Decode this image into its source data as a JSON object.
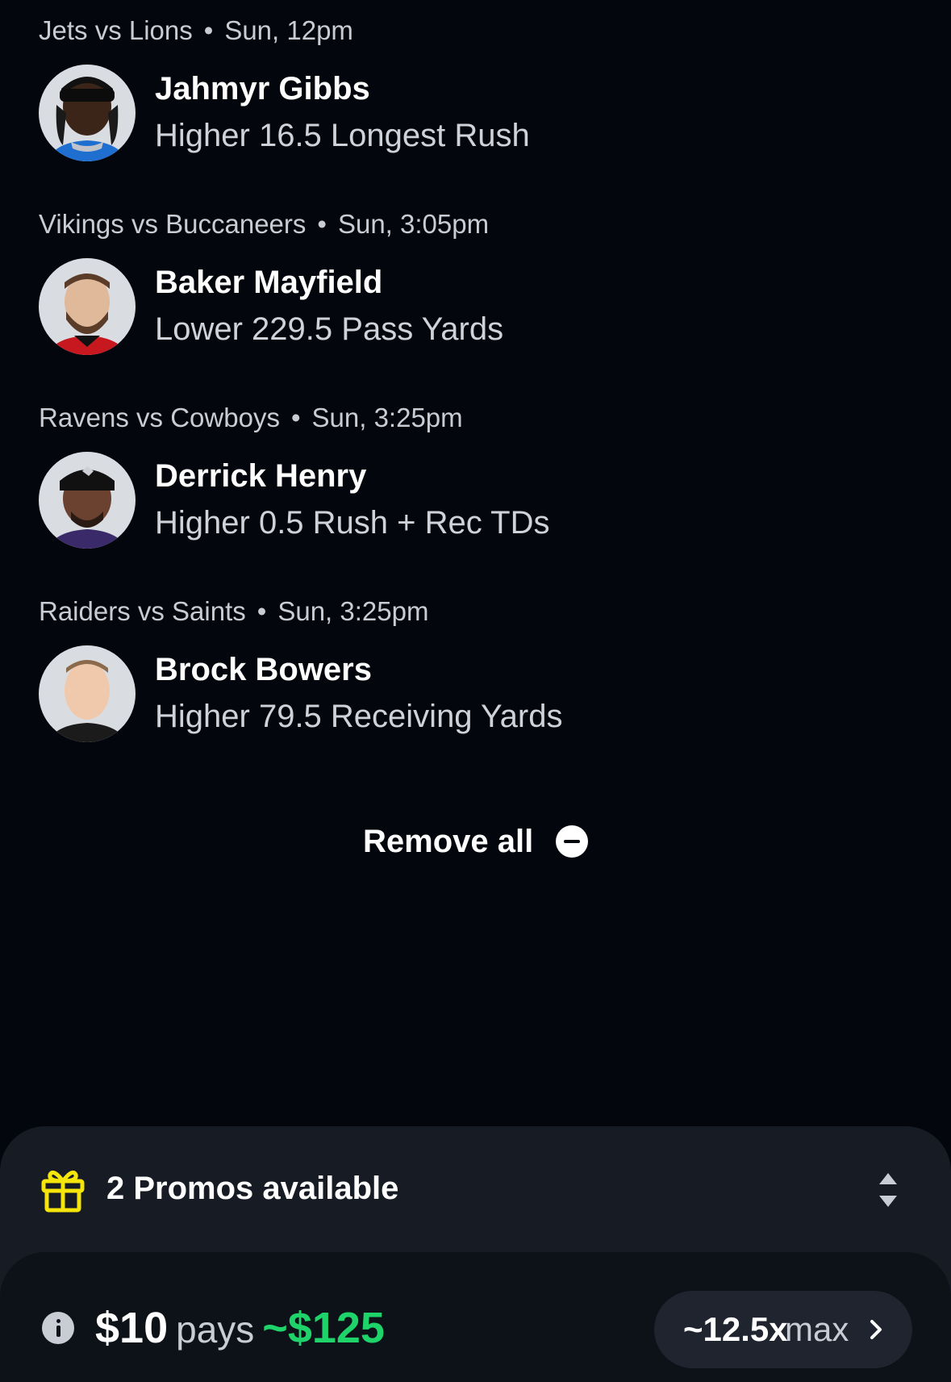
{
  "picks": [
    {
      "game": "Jets vs Lions",
      "time": "Sun, 12pm",
      "player": "Jahmyr Gibbs",
      "line": "Higher 16.5 Longest Rush"
    },
    {
      "game": "Vikings vs Buccaneers",
      "time": "Sun, 3:05pm",
      "player": "Baker Mayfield",
      "line": "Lower 229.5 Pass Yards"
    },
    {
      "game": "Ravens vs Cowboys",
      "time": "Sun, 3:25pm",
      "player": "Derrick Henry",
      "line": "Higher 0.5 Rush + Rec TDs"
    },
    {
      "game": "Raiders vs Saints",
      "time": "Sun, 3:25pm",
      "player": "Brock Bowers",
      "line": "Higher 79.5 Receiving Yards"
    }
  ],
  "separator": "•",
  "remove_all_label": "Remove all",
  "promos": {
    "label": "2 Promos available"
  },
  "payout": {
    "stake": "$10",
    "pays_label": "pays",
    "amount": "~$125",
    "multiplier": "~12.5x",
    "max_label": "max"
  },
  "colors": {
    "background": "#03060d",
    "panel": "#161b24",
    "gift_icon": "#f5e50a",
    "payout_green": "#1fd36b"
  },
  "icons": [
    "minus-circle-icon",
    "gift-icon",
    "sort-toggle-icon",
    "info-icon",
    "chevron-right-icon"
  ]
}
